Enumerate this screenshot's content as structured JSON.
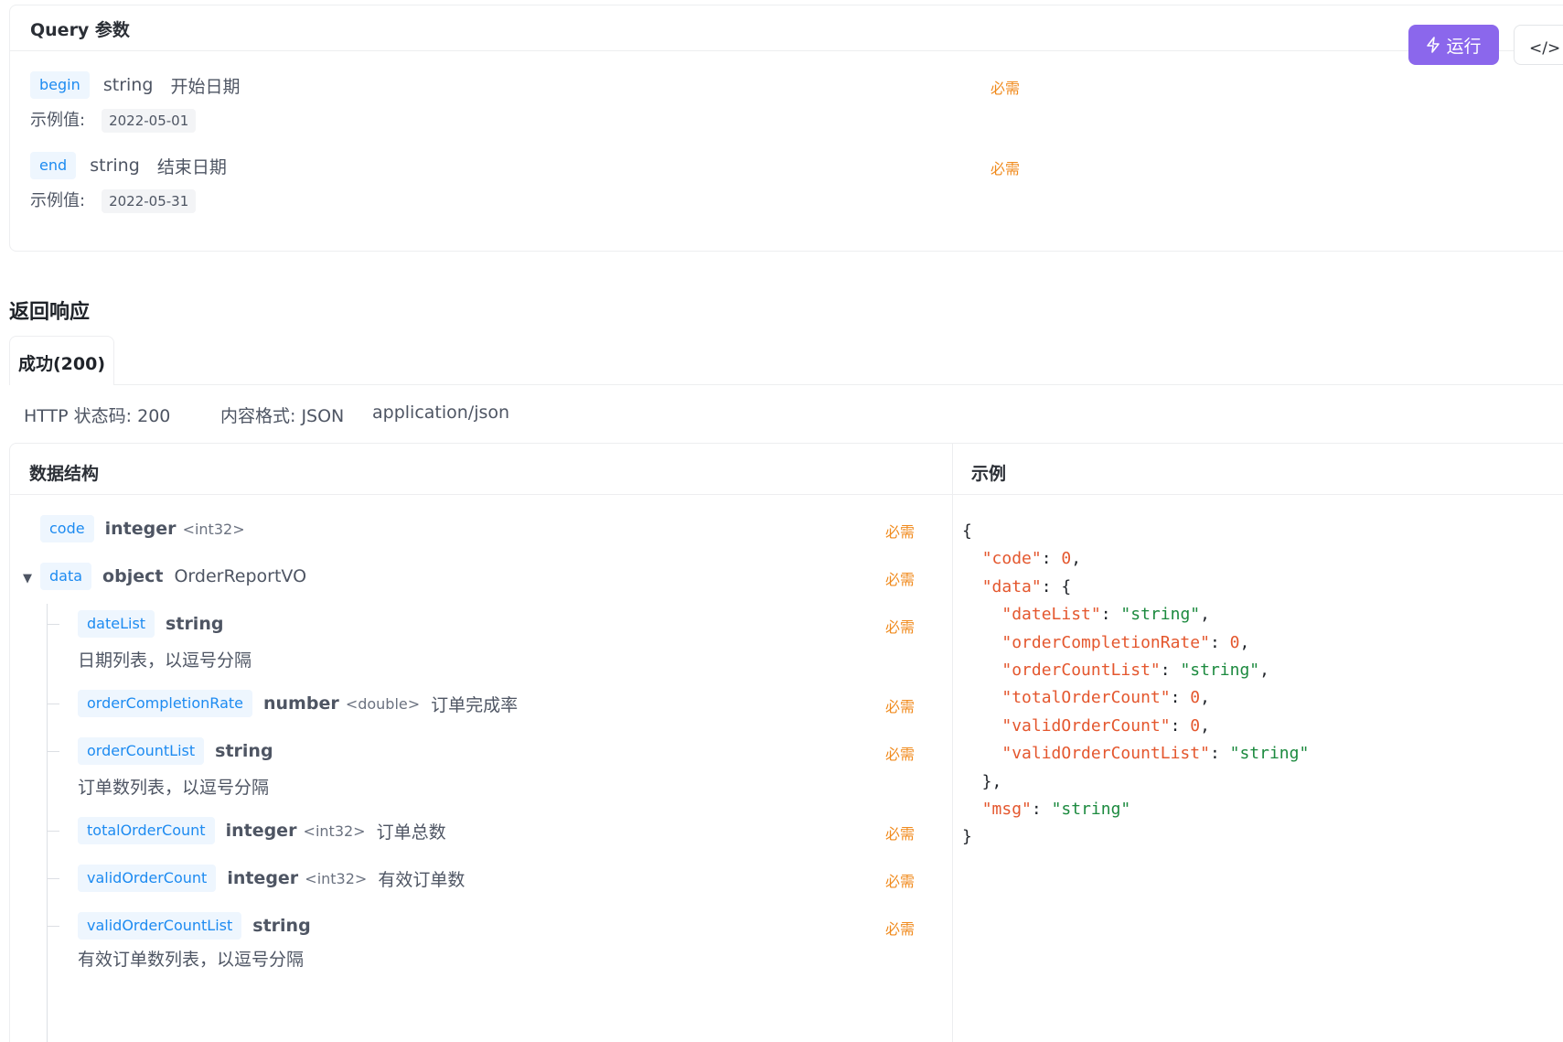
{
  "query": {
    "title": "Query 参数",
    "params": [
      {
        "name": "begin",
        "type": "string",
        "desc": "开始日期",
        "required": "必需",
        "example_label": "示例值:",
        "example": "2022-05-01"
      },
      {
        "name": "end",
        "type": "string",
        "desc": "结束日期",
        "required": "必需",
        "example_label": "示例值:",
        "example": "2022-05-31"
      }
    ]
  },
  "toolbar": {
    "run_label": "运行",
    "code_label": "</> 生"
  },
  "response": {
    "title": "返回响应",
    "tab": "成功(200)",
    "status": "HTTP 状态码: 200",
    "format": "内容格式: JSON",
    "content_type": "application/json",
    "structure_title": "数据结构",
    "example_title": "示例",
    "fields": [
      {
        "name": "code",
        "type": "integer",
        "format": "<int32>",
        "desc": "",
        "required": "必需"
      },
      {
        "name": "data",
        "type": "object",
        "format": "",
        "desc": "OrderReportVO",
        "required": "必需"
      },
      {
        "name": "dateList",
        "type": "string",
        "format": "",
        "desc": "日期列表，以逗号分隔",
        "required": "必需"
      },
      {
        "name": "orderCompletionRate",
        "type": "number",
        "format": "<double>",
        "desc": "订单完成率",
        "required": "必需"
      },
      {
        "name": "orderCountList",
        "type": "string",
        "format": "",
        "desc": "订单数列表，以逗号分隔",
        "required": "必需"
      },
      {
        "name": "totalOrderCount",
        "type": "integer",
        "format": "<int32>",
        "desc": "订单总数",
        "required": "必需"
      },
      {
        "name": "validOrderCount",
        "type": "integer",
        "format": "<int32>",
        "desc": "有效订单数",
        "required": "必需"
      },
      {
        "name": "validOrderCountList",
        "type": "string",
        "format": "",
        "desc": "有效订单数列表，以逗号分隔",
        "required": "必需"
      }
    ],
    "example_lines": [
      "{",
      "  \"code\": 0,",
      "  \"data\": {",
      "    \"dateList\": \"string\",",
      "    \"orderCompletionRate\": 0,",
      "    \"orderCountList\": \"string\",",
      "    \"totalOrderCount\": 0,",
      "    \"validOrderCount\": 0,",
      "    \"validOrderCountList\": \"string\"",
      "  },",
      "  \"msg\": \"string\"",
      "}"
    ]
  },
  "colors": {
    "accent": "#8b67ec",
    "tag_text": "#1d8bf1",
    "tag_bg": "#eef6fe",
    "required": "#f08a1c",
    "json_key": "#e4572e",
    "json_string": "#1c8a3f"
  }
}
